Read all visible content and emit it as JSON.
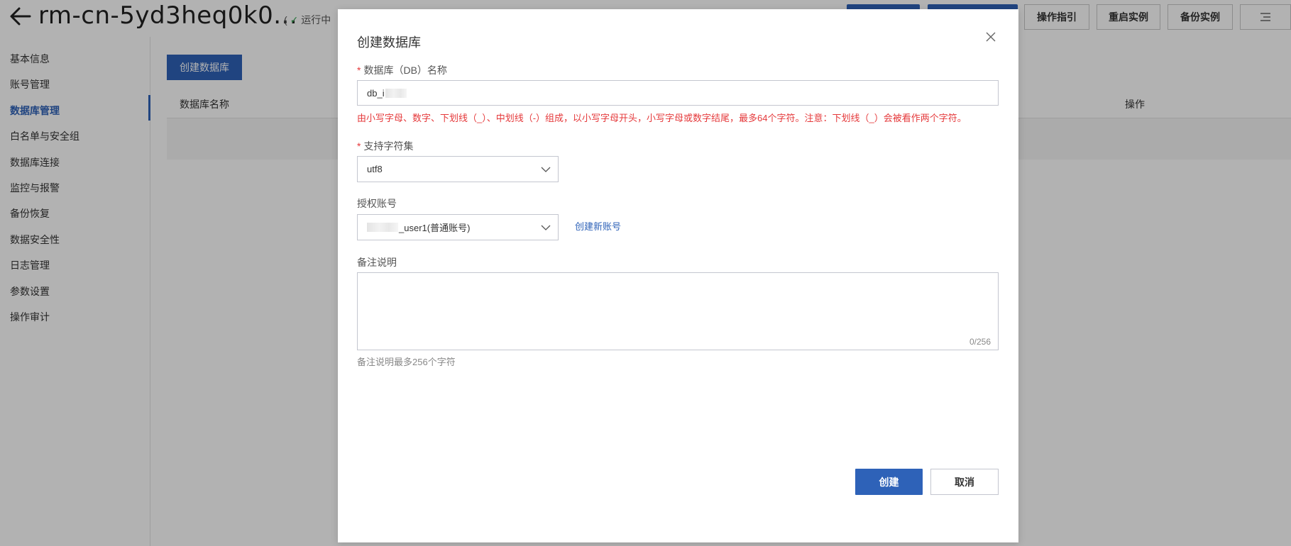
{
  "header": {
    "title": "rm-cn-5yd3heq0k0...",
    "status": "运行中",
    "status_prefix": "(",
    "buttons": [
      "操作指引",
      "重启实例",
      "备份实例"
    ]
  },
  "sidebar": {
    "items": [
      {
        "label": "基本信息"
      },
      {
        "label": "账号管理"
      },
      {
        "label": "数据库管理",
        "active": true
      },
      {
        "label": "白名单与安全组"
      },
      {
        "label": "数据库连接"
      },
      {
        "label": "监控与报警"
      },
      {
        "label": "备份恢复"
      },
      {
        "label": "数据安全性"
      },
      {
        "label": "日志管理"
      },
      {
        "label": "参数设置"
      },
      {
        "label": "操作审计"
      }
    ]
  },
  "main": {
    "create_button": "创建数据库",
    "columns": [
      "数据库名称",
      "操作"
    ]
  },
  "modal": {
    "title": "创建数据库",
    "db_name": {
      "required_mark": "*",
      "label": "数据库（DB）名称",
      "value_visible": "db_i",
      "error": "由小写字母、数字、下划线（_）、中划线（-）组成，以小写字母开头，小写字母或数字结尾，最多64个字符。注意：下划线（_）会被看作两个字符。"
    },
    "charset": {
      "required_mark": "*",
      "label": "支持字符集",
      "value": "utf8"
    },
    "account": {
      "label": "授权账号",
      "value_visible": "_user1(普通账号)",
      "create_link": "创建新账号"
    },
    "remark": {
      "label": "备注说明",
      "counter": "0/256",
      "hint": "备注说明最多256个字符"
    },
    "create_button": "创建",
    "cancel_button": "取消"
  },
  "colors": {
    "accent": "#2e62b8",
    "error": "#e5393b",
    "overlay": "rgba(0,0,0,0.30)"
  }
}
